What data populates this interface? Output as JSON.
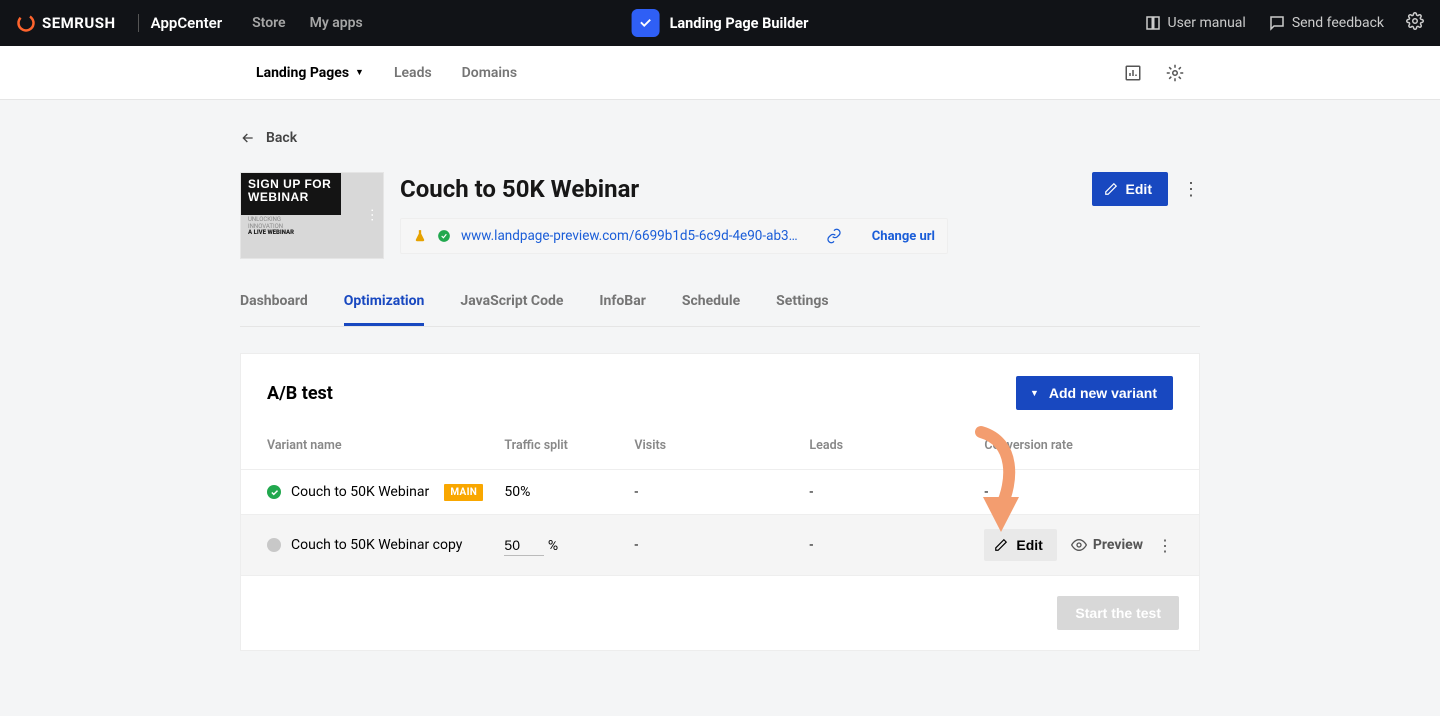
{
  "topbar": {
    "brand": "SEMRUSH",
    "appcenter": "AppCenter",
    "store": "Store",
    "myapps": "My apps",
    "app_title": "Landing Page Builder",
    "user_manual": "User manual",
    "send_feedback": "Send feedback"
  },
  "subnav": {
    "landing_pages": "Landing Pages",
    "leads": "Leads",
    "domains": "Domains"
  },
  "back": "Back",
  "page": {
    "title": "Couch to 50K Webinar",
    "url": "www.landpage-preview.com/6699b1d5-6c9d-4e90-ab3…",
    "change_url": "Change url",
    "edit": "Edit",
    "thumb_line1": "SIGN UP FOR",
    "thumb_line2": "WEBINAR",
    "thumb_sub1": "UNLOCKING",
    "thumb_sub2": "INNOVATION",
    "thumb_sub3": "A LIVE WEBINAR"
  },
  "tabs": {
    "dashboard": "Dashboard",
    "optimization": "Optimization",
    "js": "JavaScript Code",
    "infobar": "InfoBar",
    "schedule": "Schedule",
    "settings": "Settings"
  },
  "ab": {
    "title": "A/B test",
    "add_variant": "Add new variant",
    "cols": {
      "variant": "Variant name",
      "split": "Traffic split",
      "visits": "Visits",
      "leads": "Leads",
      "conv": "Conversion rate"
    },
    "rows": [
      {
        "name": "Couch to 50K Webinar",
        "main": "MAIN",
        "split_display": "50%",
        "visits": "-",
        "leads": "-",
        "conv": "-"
      },
      {
        "name": "Couch to 50K Webinar copy",
        "split_value": "50",
        "split_suffix": "%",
        "visits": "-",
        "leads": "-",
        "conv": "-"
      }
    ],
    "edit": "Edit",
    "preview": "Preview",
    "start": "Start the test"
  }
}
